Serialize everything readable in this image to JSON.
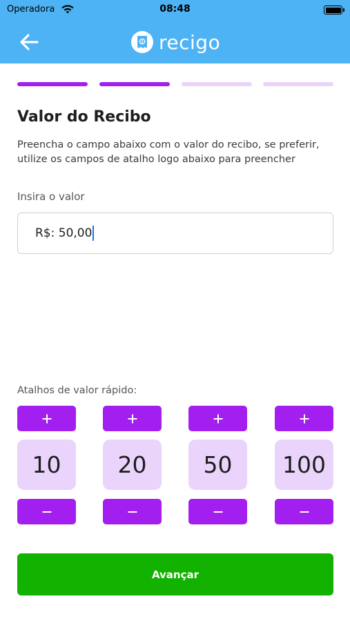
{
  "status_bar": {
    "carrier": "Operadora",
    "time": "08:48",
    "icons": [
      "wifi-icon",
      "battery-icon"
    ]
  },
  "header": {
    "app_name": "recigo",
    "back_icon": "arrow-left-icon",
    "color": "#4db3f5"
  },
  "progress": {
    "total_steps": 4,
    "completed_steps": 2,
    "active_color": "#a31ff0",
    "inactive_color": "#ead4fc"
  },
  "main": {
    "title": "Valor do Recibo",
    "description": "Preencha o campo abaixo com o valor do recibo, se preferir, utilize os campos de atalho logo abaixo para preencher",
    "input_label": "Insira o valor",
    "input_value": "R$: 50,00"
  },
  "shortcuts": {
    "label": "Atalhos de valor rápido:",
    "values": [
      "10",
      "20",
      "50",
      "100"
    ],
    "plus_icon": "plus-icon",
    "minus_icon": "minus-icon",
    "button_color": "#a31ff0",
    "tile_color": "#ead4fc"
  },
  "footer": {
    "next_label": "Avançar",
    "next_color": "#13b100"
  }
}
